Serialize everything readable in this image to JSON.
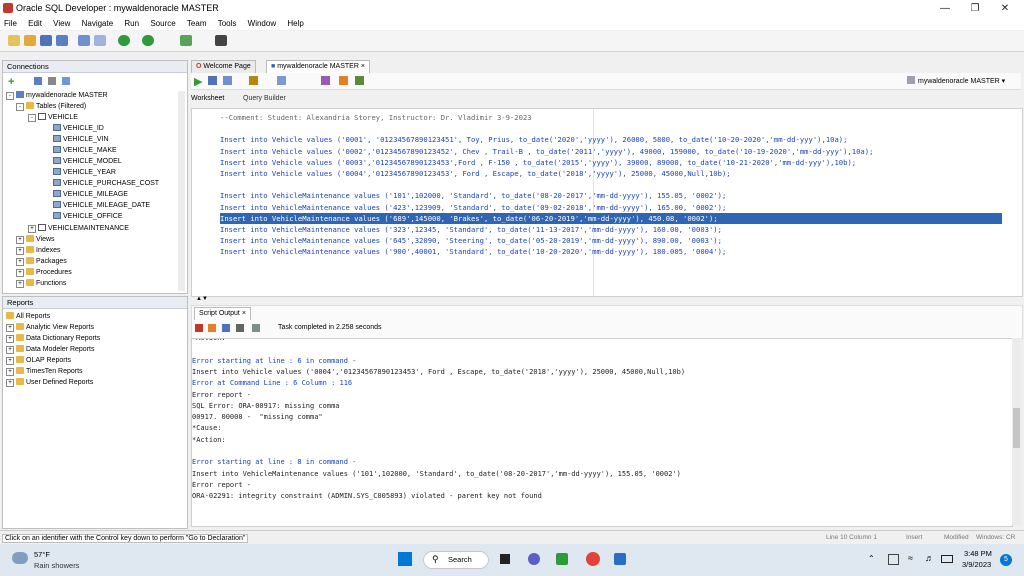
{
  "window": {
    "title": "Oracle SQL Developer : mywaldenoracle MASTER",
    "controls": {
      "minimize": "—",
      "restore": "❐",
      "close": "✕"
    }
  },
  "menu": [
    "File",
    "Edit",
    "View",
    "Navigate",
    "Run",
    "Source",
    "Team",
    "Tools",
    "Window",
    "Help"
  ],
  "connections": {
    "title": "Connections",
    "root": "mywaldenoracle MASTER",
    "tables_filtered": "Tables (Filtered)",
    "vehicle_table": "VEHICLE",
    "columns": [
      "VEHICLE_ID",
      "VEHICLE_VIN",
      "VEHICLE_MAKE",
      "VEHICLE_MODEL",
      "VEHICLE_YEAR",
      "VEHICLE_PURCHASE_COST",
      "VEHICLE_MILEAGE",
      "VEHICLE_MILEAGE_DATE",
      "VEHICLE_OFFICE"
    ],
    "maintenance_table": "VEHICLEMAINTENANCE",
    "other_nodes": [
      "Views",
      "Indexes",
      "Packages",
      "Procedures",
      "Functions"
    ]
  },
  "reports": {
    "title": "Reports",
    "items": [
      "All Reports",
      "Analytic View Reports",
      "Data Dictionary Reports",
      "Data Modeler Reports",
      "OLAP Reports",
      "TimesTen Reports",
      "User Defined Reports"
    ]
  },
  "tabs": [
    "Welcome Page",
    "mywaldenoracle MASTER"
  ],
  "connection_selector": "mywaldenoracle MASTER",
  "subtabs": [
    "Worksheet",
    "Query Builder"
  ],
  "editor": {
    "lines": [
      "--Comment: Student: Alexandria Storey, Instructor: Dr. Vladimir 3-9-2023",
      "",
      "Insert into Vehicle values ('0001', '01234567890123451', Toy, Prius, to_date('2020','yyyy'), 26000, 5800, to_date('10-20-2020','mm-dd-yyy'),10a);",
      "Insert into Vehicle values ('0002','01234567890123452', Chev , Trail-B , to_date('2011','yyyy'), 49000, 159000, to_date('10-19-2020','mm-dd-yyy'),10a);",
      "Insert into Vehicle values ('0003','01234567890123453',Ford , F-150 , to_date('2015','yyyy'), 39000, 89000, to_date('10-21-2020','mm-dd-yyy'),10b);",
      "Insert into Vehicle values ('0004','01234567890123453', Ford , Escape, to_date('2018','yyyy'), 25000, 45000,Null,10b);",
      "",
      "Insert into VehicleMaintenance values ('101',102000, 'Standard', to_date('08-20-2017','mm-dd-yyyy'), 155.05, '0002');",
      "Insert into VehicleMaintenance values ('423',123909, 'Standard', to_date('09-02-2018','mm-dd-yyyy'), 165.00, '0002');",
      "Insert into VehicleMaintenance values ('689',145000, 'Brakes', to_date('06-20-2019','mm-dd-yyyy'), 450.08, '0002');",
      "Insert into VehicleMaintenance values ('323',12345, 'Standard', to_date('11-13-2017','mm-dd-yyyy'), 160.00, '0003');",
      "Insert into VehicleMaintenance values ('645',32090, 'Steering', to_date('05-20-2019','mm-dd-yyyy'), 890.00, '0003');",
      "Insert into VehicleMaintenance values ('900',40001, 'Standard', to_date('10-20-2020','mm-dd-yyyy'), 180.005, '0004');"
    ],
    "selected_line": 9
  },
  "output": {
    "tab": "Script Output",
    "status": "Task completed in 2.258 seconds",
    "lines": [
      {
        "text": "*Action:",
        "type": "text"
      },
      {
        "text": "",
        "type": "text"
      },
      {
        "text": "Error starting at line : 6 in command -",
        "type": "err"
      },
      {
        "text": "Insert into Vehicle values ('0004','01234567890123453', Ford , Escape, to_date('2018','yyyy'), 25000, 45000,Null,10b)",
        "type": "text"
      },
      {
        "text": "Error at Command Line : 6 Column : 116",
        "type": "err"
      },
      {
        "text": "Error report -",
        "type": "text"
      },
      {
        "text": "SQL Error: ORA-00917: missing comma",
        "type": "text"
      },
      {
        "text": "00917. 00000 -  \"missing comma\"",
        "type": "text"
      },
      {
        "text": "*Cause:",
        "type": "text"
      },
      {
        "text": "*Action:",
        "type": "text"
      },
      {
        "text": "",
        "type": "text"
      },
      {
        "text": "Error starting at line : 8 in command -",
        "type": "err"
      },
      {
        "text": "Insert into VehicleMaintenance values ('101',102000, 'Standard', to_date('08-20-2017','mm-dd-yyyy'), 155.05, '0002')",
        "type": "text"
      },
      {
        "text": "Error report -",
        "type": "text"
      },
      {
        "text": "ORA-02291: integrity constraint (ADMIN.SYS_C005893) violated - parent key not found",
        "type": "text"
      }
    ]
  },
  "statusbar": {
    "left": "Click on an identifier with the Control key down to perform \"Go to Declaration\"",
    "line_col": "Line 10 Column 1",
    "mode": "Insert",
    "modified": "Modified",
    "eol": "Windows: CR"
  },
  "taskbar": {
    "temp": "57°F",
    "weather": "Rain showers",
    "search": "Search",
    "time": "3:48 PM",
    "date": "3/9/2023",
    "notifications": "5"
  }
}
